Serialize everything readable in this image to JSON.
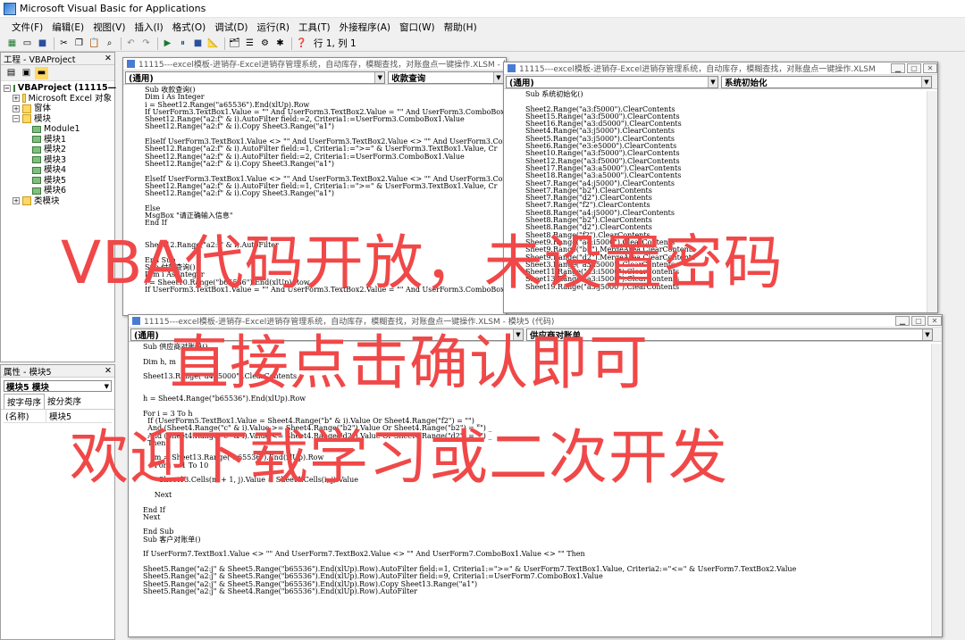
{
  "app": {
    "title": "Microsoft Visual Basic for Applications"
  },
  "menu": [
    "文件(F)",
    "编辑(E)",
    "视图(V)",
    "插入(I)",
    "格式(O)",
    "调试(D)",
    "运行(R)",
    "工具(T)",
    "外接程序(A)",
    "窗口(W)",
    "帮助(H)"
  ],
  "toolbar": {
    "position": "行 1, 列 1"
  },
  "project_panel": {
    "title": "工程 - VBAProject",
    "root": "VBAProject (11115—",
    "nodes": [
      "Microsoft Excel 对象",
      "窗体",
      "模块",
      "Module1",
      "模块1",
      "模块2",
      "模块3",
      "模块4",
      "模块5",
      "模块6",
      "类模块"
    ]
  },
  "props_panel": {
    "title": "属性 - 模块5",
    "object": "模块5 模块",
    "tab_alpha": "按字母序",
    "tab_cat": "按分类序",
    "row_name": "(名称)",
    "row_value": "模块5"
  },
  "win1": {
    "title": "11115---excel模板-进销存-Excel进销存管理系统，自动库存，模糊查找，对账盘点一键操作.XLSM - 模块3 (代码)",
    "left": "(通用)",
    "right": "收款查询",
    "code": "Sub 收款查询()\nDim i As Integer\ni = Sheet12.Range(\"a65536\").End(xlUp).Row\nIf UserForm3.TextBox1.Value = \"\" And UserForm3.TextBox2.Value = \"\" And UserForm3.ComboBox1.Va\nSheet12.Range(\"a2:f\" & i).AutoFilter field:=2, Criteria1:=UserForm3.ComboBox1.Value\nSheet12.Range(\"a2:f\" & i).Copy Sheet3.Range(\"a1\")\n\nElseIf UserForm3.TextBox1.Value <> \"\" And UserForm3.TextBox2.Value <> \"\" And UserForm3.ComboB\nSheet12.Range(\"a2:f\" & i).AutoFilter field:=1, Criteria1:=\">=\" & UserForm3.TextBox1.Value, Cr\nSheet12.Range(\"a2:f\" & i).AutoFilter field:=2, Criteria1:=UserForm3.ComboBox1.Value\nSheet12.Range(\"a2:f\" & i).Copy Sheet3.Range(\"a1\")\n\nElseIf UserForm3.TextBox1.Value <> \"\" And UserForm3.TextBox2.Value <> \"\" And UserForm3.ComboB\nSheet12.Range(\"a2:f\" & i).AutoFilter field:=1, Criteria1:=\">=\" & UserForm3.TextBox1.Value, Cr\nSheet12.Range(\"a2:f\" & i).Copy Sheet3.Range(\"a1\")\n\nElse\nMsgBox \"请正确输入信息\"\nEnd If\n\n\nSheet12.Range(\"a2:f\" & i).AutoFilter\n\nEnd Sub\nSub 付款查询()\nDim i As Integer\ni = Sheet10.Range(\"b65536\").End(xlUp).Row\nIf UserForm3.TextBox1.Value = \"\" And UserForm3.TextBox2.Value = \"\" And UserForm3.ComboBox1.Va"
  },
  "win2": {
    "title": "11115---excel模板-进销存-Excel进销存管理系统，自动库存，模糊查找，对账盘点一键操作.XLSM - 模块 (代码)",
    "left": "(通用)",
    "right": "系统初始化",
    "code": "Sub 系统初始化()\n\nSheet2.Range(\"a3:f5000\").ClearContents\nSheet15.Range(\"a3:f5000\").ClearContents\nSheet16.Range(\"a3:d5000\").ClearContents\nSheet4.Range(\"a3:j5000\").ClearContents\nSheet5.Range(\"a3:j5000\").ClearContents\nSheet6.Range(\"e3:e5000\").ClearContents\nSheet10.Range(\"a3:f5000\").ClearContents\nSheet12.Range(\"a3:f5000\").ClearContents\nSheet17.Range(\"a3:a5000\").ClearContents\nSheet18.Range(\"a3:a5000\").ClearContents\nSheet7.Range(\"a4:j5000\").ClearContents\nSheet7.Range(\"b2\").ClearContents\nSheet7.Range(\"d2\").ClearContents\nSheet7.Range(\"f2\").ClearContents\nSheet8.Range(\"a4:j5000\").ClearContents\nSheet8.Range(\"b2\").ClearContents\nSheet8.Range(\"d2\").ClearContents\nSheet8.Range(\"f2\").ClearContents\nSheet9.Range(\"a4:i5000\").ClearContents\nSheet9.Range(\"b2\").MergeArea.ClearContents\nSheet9.Range(\"d2\").MergeArea.ClearContents\nSheet3.Range(\"a3:i5000\").ClearContents\nSheet11.Range(\"a3:i5000\").ClearContents\nSheet13.Range(\"a3:i5000\").ClearContents\nSheet19.Range(\"a3:j5000\").ClearContents"
  },
  "win3": {
    "title": "11115---excel模板-进销存-Excel进销存管理系统，自动库存，模糊查找，对账盘点一键操作.XLSM - 模块5 (代码)",
    "left": "(通用)",
    "right": "供应商对账单",
    "code": "Sub 供应商对账单()\n\nDim h, m\n\nSheet13.Range(\"a4:j5000\").ClearContents\n\n\nh = Sheet4.Range(\"b65536\").End(xlUp).Row\n\nFor i = 3 To h\n  If (UserForm5.TextBox1.Value = Sheet4.Range(\"b\" & i).Value Or Sheet4.Range(\"f2\") = \"\") _\n  And (Sheet4.Range(\"c\" & i).Value >= Sheet4.Range(\"b2\").Value Or Sheet4.Range(\"b2\") = \"\") _\n  And (Sheet4.Range(\"c\" & i).Value <= Sheet4.Range(\"d2\").Value Or Sheet4.Range(\"d2\") = \"\") _\n  Then\n\n     m = Sheet13.Range(\"b65536\").End(xlUp).Row\n     For j = 1 To 10\n\n       Sheet13.Cells(m + 1, j).Value = Sheet4.Cells(i, j).Value\n\n     Next\n\nEnd If\nNext\n\nEnd Sub\nSub 客户对账单()\n\nIf UserForm7.TextBox1.Value <> \"\" And UserForm7.TextBox2.Value <> \"\" And UserForm7.ComboBox1.Value <> \"\" Then\n\nSheet5.Range(\"a2:j\" & Sheet5.Range(\"b65536\").End(xlUp).Row).AutoFilter field:=1, Criteria1:=\">=\" & UserForm7.TextBox1.Value, Criteria2:=\"<=\" & UserForm7.TextBox2.Value\nSheet5.Range(\"a2:j\" & Sheet5.Range(\"b65536\").End(xlUp).Row).AutoFilter field:=9, Criteria1:=UserForm7.ComboBox1.Value\nSheet5.Range(\"a2:j\" & Sheet5.Range(\"b65536\").End(xlUp).Row).Copy Sheet13.Range(\"a1\")\nSheet5.Range(\"a2:j\" & Sheet4.Range(\"b65536\").End(xlUp).Row).AutoFilter"
  },
  "overlay": {
    "line1": "VBA代码开放，未设置密码",
    "line2": "直接点击确认即可",
    "line3": "欢迎下载学习或二次开发"
  },
  "colors": {
    "overlay_red": "#f04848",
    "keyword_blue": "#00008b"
  }
}
